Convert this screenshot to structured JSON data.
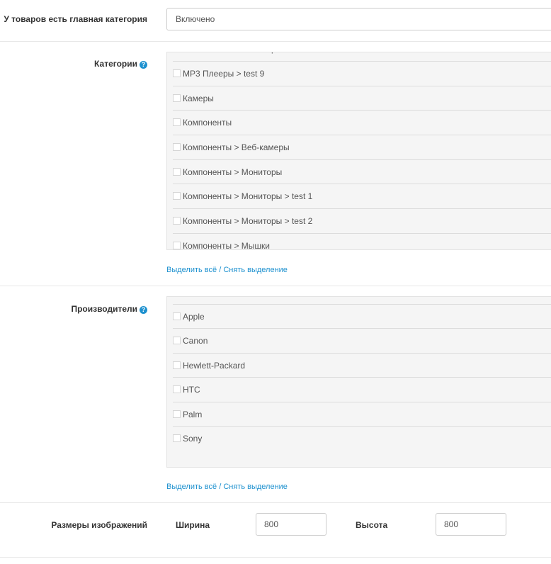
{
  "main_category": {
    "label": "У товаров есть главная категория",
    "value": "Включено"
  },
  "categories": {
    "label": "Категории",
    "help_icon": "?",
    "items": [
      "МР3 Плееры  >  test 9",
      "Камеры",
      "Компоненты",
      "Компоненты  >  Веб-камеры",
      "Компоненты  >  Мониторы",
      "Компоненты  >  Мониторы  >  test 1",
      "Компоненты  >  Мониторы  >  test 2",
      "Компоненты  >  Мышки"
    ],
    "select_all": "Выделить всё",
    "separator": " / ",
    "deselect": "Снять выделение"
  },
  "manufacturers": {
    "label": "Производители",
    "help_icon": "?",
    "items": [
      "Apple",
      "Canon",
      "Hewlett-Packard",
      "HTC",
      "Palm",
      "Sony"
    ],
    "select_all": "Выделить всё",
    "separator": " / ",
    "deselect": "Снять выделение"
  },
  "image_sizes": {
    "label": "Размеры изображений",
    "width_label": "Ширина",
    "width_value": "800",
    "height_label": "Высота",
    "height_value": "800"
  }
}
